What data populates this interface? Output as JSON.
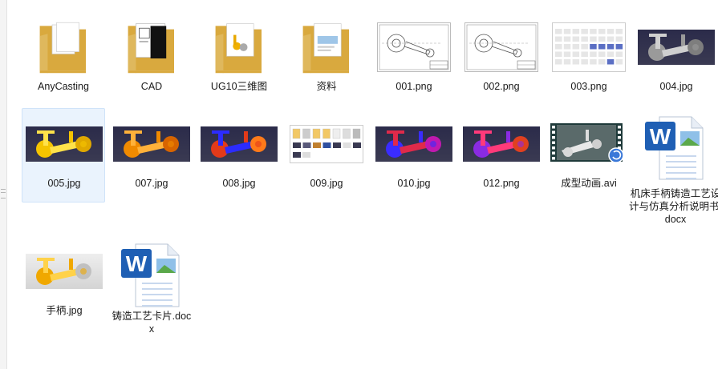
{
  "files": [
    {
      "name": "AnyCasting",
      "kind": "folder",
      "preview": "docs"
    },
    {
      "name": "CAD",
      "kind": "folder",
      "preview": "cad"
    },
    {
      "name": "UG10三维图",
      "kind": "folder",
      "preview": "model"
    },
    {
      "name": "资料",
      "kind": "folder",
      "preview": "image"
    },
    {
      "name": "001.png",
      "kind": "drawing"
    },
    {
      "name": "002.png",
      "kind": "drawing"
    },
    {
      "name": "003.png",
      "kind": "sheet"
    },
    {
      "name": "004.jpg",
      "kind": "render",
      "scheme": "gray"
    },
    {
      "name": "005.jpg",
      "kind": "render",
      "scheme": "yellow",
      "selected": true
    },
    {
      "name": "007.jpg",
      "kind": "render",
      "scheme": "orange"
    },
    {
      "name": "008.jpg",
      "kind": "render",
      "scheme": "redblue"
    },
    {
      "name": "009.jpg",
      "kind": "collage"
    },
    {
      "name": "010.jpg",
      "kind": "render",
      "scheme": "bluered"
    },
    {
      "name": "012.png",
      "kind": "render",
      "scheme": "purple"
    },
    {
      "name": "成型动画.avi",
      "kind": "video"
    },
    {
      "name": "机床手柄铸造工艺设计与仿真分析说明书.docx",
      "kind": "word"
    },
    {
      "name": "手柄.jpg",
      "kind": "render",
      "scheme": "handle"
    },
    {
      "name": "铸造工艺卡片.docx",
      "kind": "word"
    }
  ],
  "colors": {
    "folder": "#f2c865",
    "folder_dark": "#d9a93e",
    "selection": "#eaf3fd",
    "word_blue": "#1f5fb4"
  }
}
